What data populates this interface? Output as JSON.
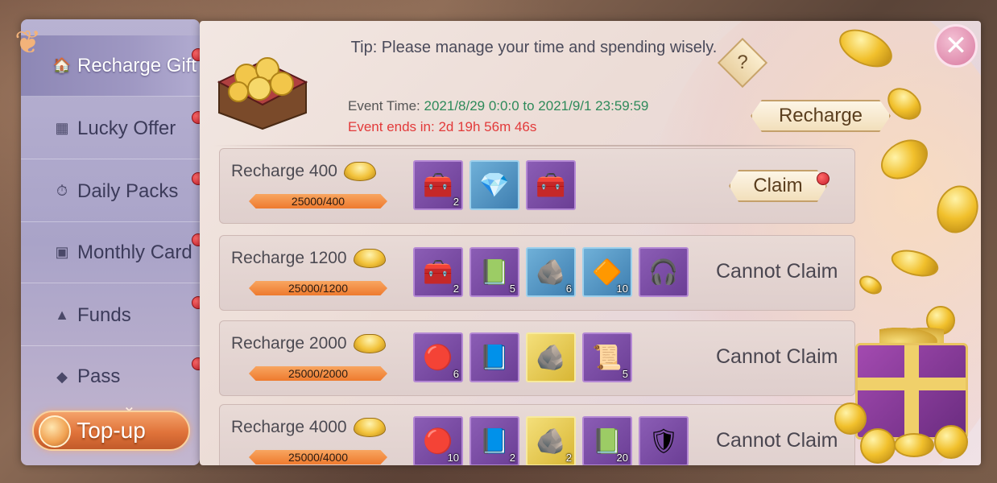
{
  "sidebar": {
    "items": [
      {
        "label": "Recharge Gift",
        "icon": "gift-shop-icon",
        "active": true
      },
      {
        "label": "Lucky Offer",
        "icon": "ticket-icon",
        "active": false
      },
      {
        "label": "Daily Packs",
        "icon": "calendar-gift-icon",
        "active": false
      },
      {
        "label": "Monthly Card",
        "icon": "card-icon",
        "active": false
      },
      {
        "label": "Funds",
        "icon": "chart-icon",
        "active": false
      },
      {
        "label": "Pass",
        "icon": "diamond-badge-icon",
        "active": false
      }
    ],
    "topup_label": "Top-up"
  },
  "header": {
    "tip": "Tip: Please manage your time and spending wisely.",
    "help_label": "?",
    "event_time_label": "Event Time:",
    "event_time_value": "2021/8/29 0:0:0 to 2021/9/1 23:59:59",
    "event_ends": "Event ends in: 2d 19h 56m 46s",
    "recharge_button": "Recharge"
  },
  "rows": [
    {
      "label": "Recharge 400",
      "progress": "25000/400",
      "status": "Claim",
      "claimable": true,
      "items": [
        {
          "type": "purple",
          "icon": "chest",
          "qty": "2"
        },
        {
          "type": "blue",
          "icon": "gem",
          "qty": ""
        },
        {
          "type": "purple",
          "icon": "chest",
          "qty": ""
        }
      ]
    },
    {
      "label": "Recharge 1200",
      "progress": "25000/1200",
      "status": "Cannot Claim",
      "claimable": false,
      "items": [
        {
          "type": "purple",
          "icon": "chest",
          "qty": "2"
        },
        {
          "type": "purple",
          "icon": "book",
          "qty": "5"
        },
        {
          "type": "blue",
          "icon": "ore",
          "qty": "6"
        },
        {
          "type": "blue",
          "icon": "crystal",
          "qty": "10"
        },
        {
          "type": "purple",
          "icon": "headphones",
          "qty": ""
        }
      ]
    },
    {
      "label": "Recharge 2000",
      "progress": "25000/2000",
      "status": "Cannot Claim",
      "claimable": false,
      "items": [
        {
          "type": "purple",
          "icon": "orb",
          "qty": "6"
        },
        {
          "type": "purple",
          "icon": "blue-book",
          "qty": ""
        },
        {
          "type": "gold",
          "icon": "ore",
          "qty": ""
        },
        {
          "type": "purple",
          "icon": "scroll",
          "qty": "5"
        }
      ]
    },
    {
      "label": "Recharge 4000",
      "progress": "25000/4000",
      "status": "Cannot Claim",
      "claimable": false,
      "items": [
        {
          "type": "purple",
          "icon": "orb",
          "qty": "10"
        },
        {
          "type": "purple",
          "icon": "blue-book",
          "qty": "2"
        },
        {
          "type": "gold",
          "icon": "ore",
          "qty": "2"
        },
        {
          "type": "purple",
          "icon": "book",
          "qty": "20"
        },
        {
          "type": "purple",
          "icon": "armor",
          "qty": ""
        }
      ]
    }
  ],
  "close_label": "✕",
  "colors": {
    "accent_green": "#2e8a5a",
    "accent_red": "#e23a3a",
    "progress_orange": "#ee7a2e",
    "sidebar_active": "#8d87b5"
  }
}
